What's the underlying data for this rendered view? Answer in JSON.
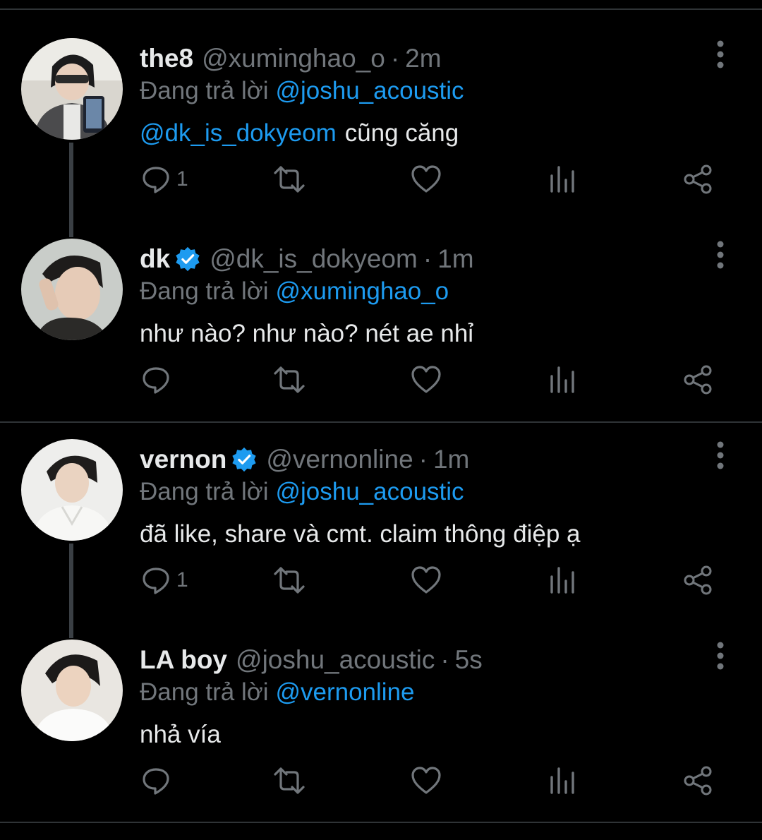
{
  "theme": {
    "bg": "#000000",
    "text": "#e7e9ea",
    "muted": "#71767b",
    "link": "#1d9bf0",
    "verified": "#1d9bf0"
  },
  "tweets": [
    {
      "name": "the8",
      "verified": false,
      "handle": "@xuminghao_o",
      "separator": "·",
      "time": "2m",
      "reply_prefix": "Đang trả lời",
      "reply_to": "@joshu_acoustic",
      "mention": "@dk_is_dokyeom",
      "text": "cũng căng",
      "reply_count": "1",
      "icons": [
        "reply-icon",
        "retweet-icon",
        "like-icon",
        "views-icon",
        "share-icon",
        "more-icon"
      ]
    },
    {
      "name": "dk",
      "verified": true,
      "handle": "@dk_is_dokyeom",
      "separator": "·",
      "time": "1m",
      "reply_prefix": "Đang trả lời",
      "reply_to": "@xuminghao_o",
      "mention": "",
      "text": "như nào? như nào? nét ae nhỉ",
      "reply_count": ""
    },
    {
      "name": "vernon",
      "verified": true,
      "handle": "@vernonline",
      "separator": "·",
      "time": "1m",
      "reply_prefix": "Đang trả lời",
      "reply_to": "@joshu_acoustic",
      "mention": "",
      "text": "đã like, share và cmt. claim thông điệp ạ",
      "reply_count": "1"
    },
    {
      "name": "LA boy",
      "verified": false,
      "handle": "@joshu_acoustic",
      "separator": "·",
      "time": "5s",
      "reply_prefix": "Đang trả lời",
      "reply_to": "@vernonline",
      "mention": "",
      "text": "nhả vía",
      "reply_count": ""
    }
  ]
}
